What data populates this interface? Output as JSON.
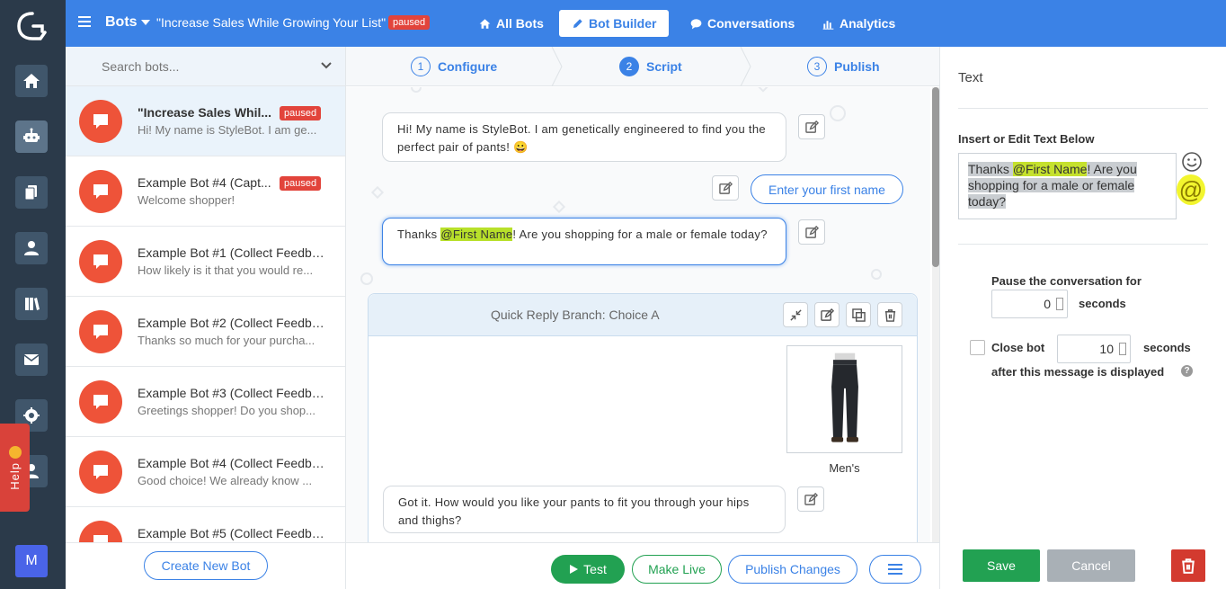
{
  "colors": {
    "primary": "#3b82e6",
    "accent_red": "#ee5339",
    "badge_red": "#e2443b",
    "success": "#22a152",
    "rail": "#2b3a4a"
  },
  "header": {
    "section": "Bots",
    "bot_name": "\"Increase Sales While Growing Your List\"",
    "status_badge": "paused",
    "nav": [
      {
        "label": "All Bots",
        "icon": "home-icon"
      },
      {
        "label": "Bot Builder",
        "icon": "pencil-icon",
        "active": true
      },
      {
        "label": "Conversations",
        "icon": "chat-icon"
      },
      {
        "label": "Analytics",
        "icon": "bar-chart-icon"
      }
    ]
  },
  "rail": {
    "help_label": "Help",
    "user_initial": "M"
  },
  "bot_list": {
    "search_placeholder": "Search bots...",
    "items": [
      {
        "name": "\"Increase Sales Whil...",
        "preview": "Hi! My name is StyleBot. I am ge...",
        "badge": "paused",
        "active": true
      },
      {
        "name": "Example Bot #4 (Capt...",
        "preview": "Welcome shopper!",
        "badge": "paused"
      },
      {
        "name": "Example Bot #1 (Collect Feedba...",
        "preview": "How likely is it that you would re..."
      },
      {
        "name": "Example Bot #2 (Collect Feedba...",
        "preview": "Thanks so much for your purcha..."
      },
      {
        "name": "Example Bot #3 (Collect Feedba...",
        "preview": "Greetings shopper! Do you shop..."
      },
      {
        "name": "Example Bot #4 (Collect Feedba...",
        "preview": "Good choice! We already know ..."
      },
      {
        "name": "Example Bot #5 (Collect Feedba...",
        "preview": ""
      }
    ],
    "create_button": "Create New Bot"
  },
  "steps": [
    {
      "num": "1",
      "label": "Configure"
    },
    {
      "num": "2",
      "label": "Script",
      "active": true
    },
    {
      "num": "3",
      "label": "Publish"
    }
  ],
  "script": {
    "msg1": "Hi! My name is StyleBot. I am genetically engineered to find you the perfect pair of pants! 😀",
    "quick_reply": "Enter your first name",
    "msg2_pre": "Thanks ",
    "msg2_tag": "@First Name",
    "msg2_post": "! Are you shopping for a male or female today?",
    "branch_title": "Quick Reply Branch: Choice A",
    "product_label": "Men's",
    "msg3": "Got it. How would you like your pants to fit you through your hips and thighs?"
  },
  "bottom_bar": {
    "test": "Test",
    "make_live": "Make Live",
    "publish": "Publish Changes"
  },
  "panel": {
    "title": "Text",
    "label": "Insert or Edit Text Below",
    "text_pre": "Thanks ",
    "text_tag": "@First Name",
    "text_post": "! Are you shopping for a male or female today?",
    "at_symbol": "@",
    "pause_label": "Pause the conversation for",
    "pause_value": "0",
    "pause_unit": "seconds",
    "close_label": "Close bot",
    "close_value": "10",
    "close_unit": "seconds",
    "close_after": "after this message is displayed",
    "help_mark": "?",
    "save": "Save",
    "cancel": "Cancel"
  }
}
